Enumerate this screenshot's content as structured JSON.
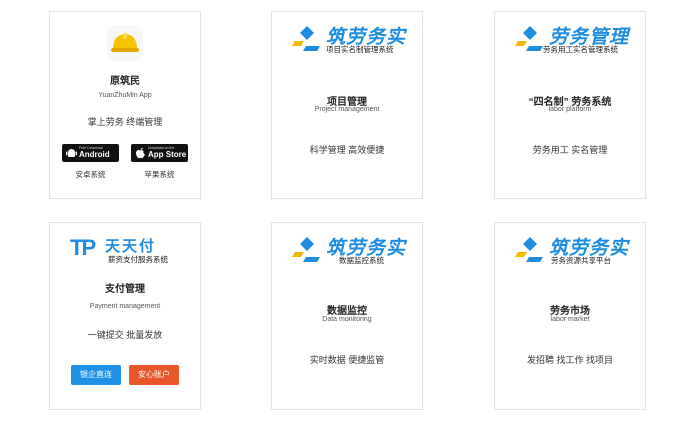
{
  "cards": [
    {
      "app_name": "原筑民",
      "app_sub": "YuanZhuMin App",
      "desc": "掌上劳务 终端管理",
      "android": {
        "small": "Free Download",
        "big": "Android",
        "caption": "安卓系统"
      },
      "ios": {
        "small": "Download on the",
        "big": "App Store",
        "caption": "苹果系统"
      }
    },
    {
      "logo_text": "筑劳务实",
      "logo_sub": "项目实名制管理系统",
      "title": "项目管理",
      "sub": "Project management",
      "desc": "科学管理 高效便捷"
    },
    {
      "logo_text": "劳务管理",
      "logo_sub": "劳务用工实名管理系统",
      "title": "“四名制” 劳务系统",
      "sub": "labor platform",
      "desc": "劳务用工 实名管理"
    },
    {
      "logo_mark": "TP",
      "logo_text": "天天付",
      "logo_sub": "薪资支付服务系统",
      "title": "支付管理",
      "sub": "Payment management",
      "desc": "一键提交 批量发放",
      "btn_blue": "银企直连",
      "btn_red": "安心账户"
    },
    {
      "logo_text": "筑劳务实",
      "logo_sub": "数据监控系统",
      "title": "数据监控",
      "sub": "Data monitoring",
      "desc": "实时数据 便捷监管"
    },
    {
      "logo_text": "筑劳务实",
      "logo_sub": "劳务资源共享平台",
      "title": "劳务市场",
      "sub": "labor market",
      "desc": "发招聘 找工作 找项目"
    }
  ],
  "colors": {
    "blue": "#1c8de0",
    "yellow": "#f5b800",
    "red": "#e8562a",
    "btn_blue": "#1e90e6"
  }
}
